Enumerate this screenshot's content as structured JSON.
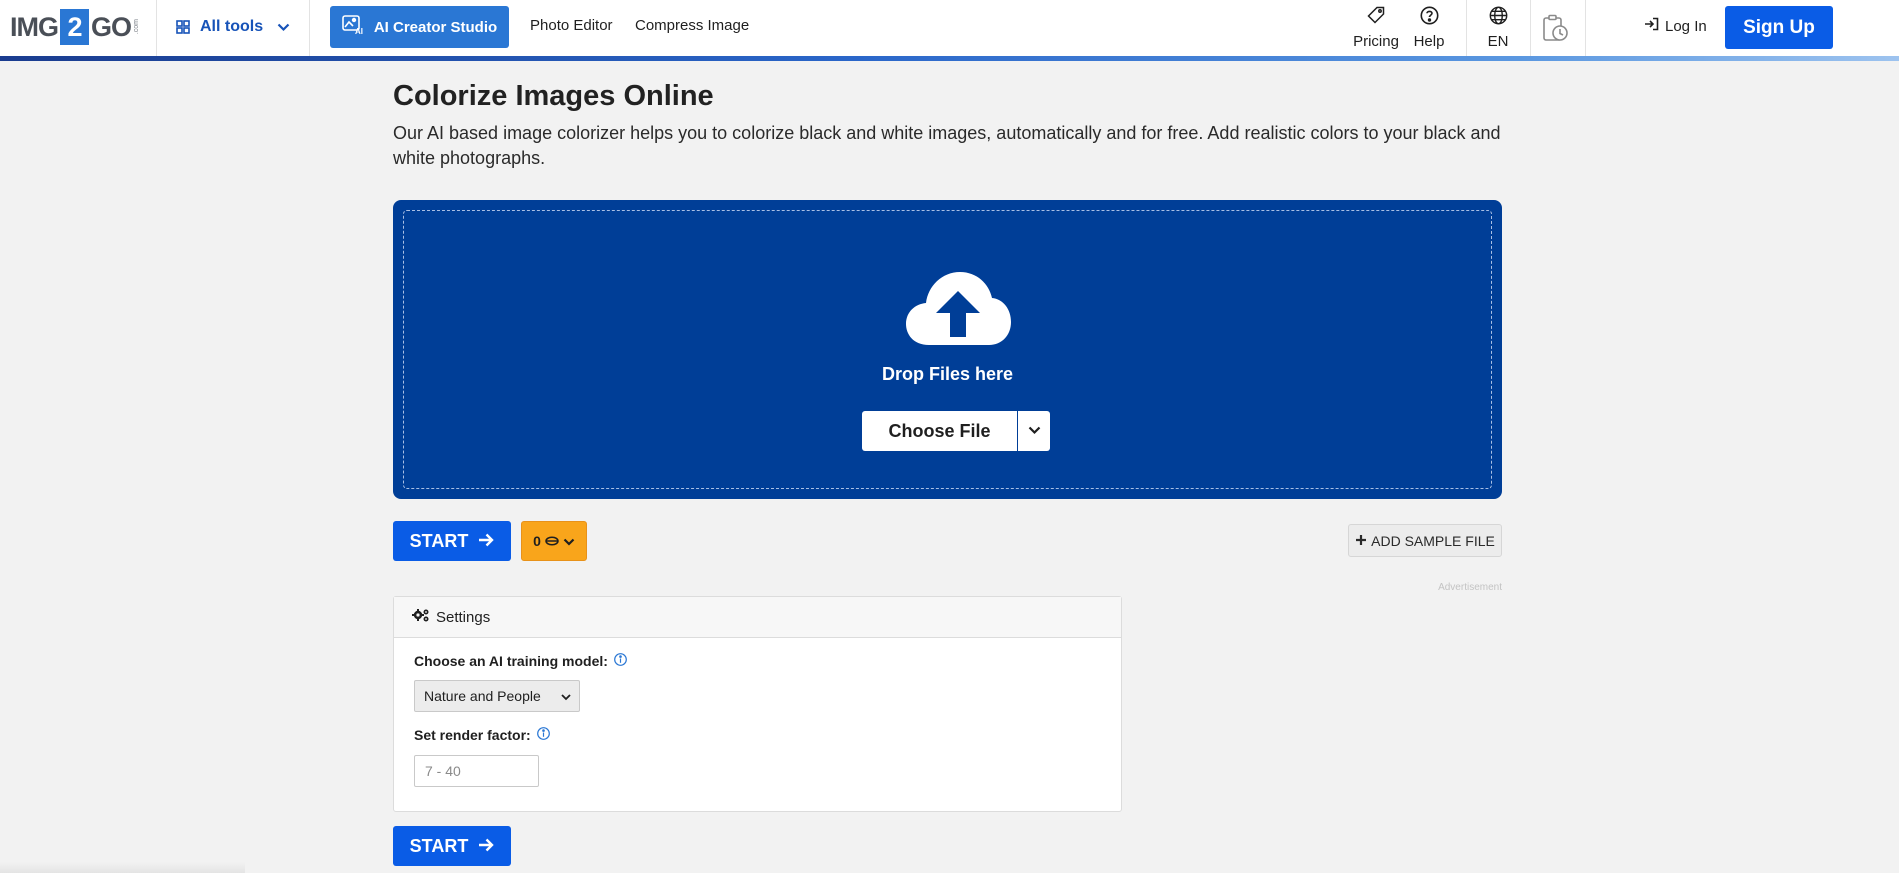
{
  "header": {
    "logo": {
      "prefix": "IMG",
      "number": "2",
      "suffix": "GO",
      "tld": ".com"
    },
    "all_tools_label": "All tools",
    "ai_creator_label": "AI Creator Studio",
    "nav_links": [
      "Photo Editor",
      "Compress Image"
    ],
    "pricing_label": "Pricing",
    "help_label": "Help",
    "language_label": "EN",
    "login_label": "Log In",
    "signup_label": "Sign Up"
  },
  "main": {
    "title": "Colorize Images Online",
    "description": "Our AI based image colorizer helps you to colorize black and white images, automatically and for free. Add realistic colors to your black and white photographs.",
    "dropzone": {
      "drop_text": "Drop Files here",
      "choose_file_label": "Choose File"
    },
    "start_label": "START",
    "credits_value": "0",
    "add_sample_label": "ADD SAMPLE FILE",
    "advertisement_label": "Advertisement",
    "settings": {
      "heading": "Settings",
      "model_label": "Choose an AI training model:",
      "model_selected": "Nature and People",
      "render_label": "Set render factor:",
      "render_placeholder": "7 - 40"
    },
    "start_label_bottom": "START"
  },
  "colors": {
    "brand_blue": "#0a5ce6",
    "dropzone_blue": "#003e97",
    "credits_orange": "#f9a51b",
    "link_blue": "#1753b8"
  },
  "icons": {
    "all_tools": "grid-icon",
    "ai_creator": "ai-image-icon",
    "pricing": "tag-icon",
    "help": "question-circle-icon",
    "language": "globe-icon",
    "history": "clipboard-clock-icon",
    "login": "sign-in-icon",
    "upload": "cloud-upload-icon",
    "start": "arrow-right-icon",
    "credits": "coin-icon",
    "sample": "plus-icon",
    "settings": "gears-icon",
    "info": "info-circle-icon"
  }
}
